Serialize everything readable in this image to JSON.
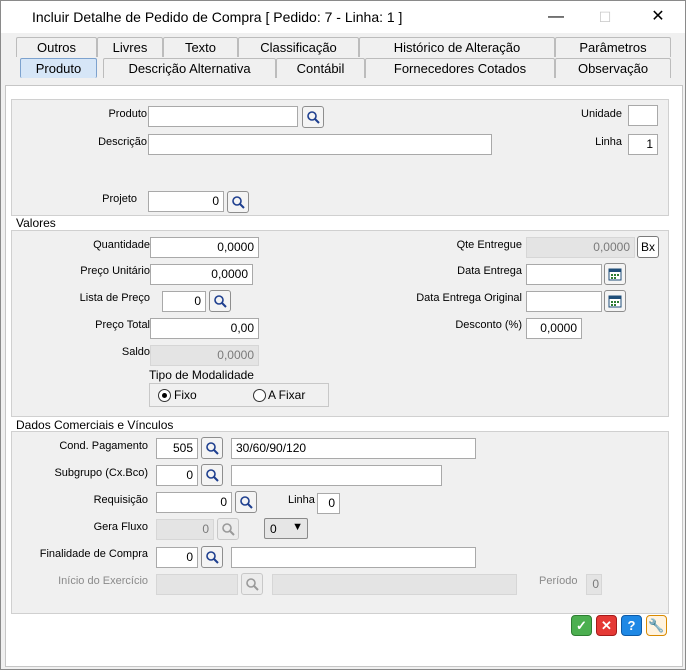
{
  "window": {
    "title": "Incluir Detalhe de Pedido de Compra [ Pedido: 7  -  Linha: 1 ]",
    "minimize_glyph": "—",
    "maximize_glyph": "☐",
    "close_glyph": "✕"
  },
  "tabs_row1": [
    "Outros",
    "Livres",
    "Texto",
    "Classificação",
    "Histórico de Alteração",
    "Parâmetros"
  ],
  "tabs_row2": [
    "Produto",
    "Descrição Alternativa",
    "Contábil",
    "Fornecedores Cotados",
    "Observação"
  ],
  "active_tab": "Produto",
  "produto": {
    "produto_label": "Produto",
    "produto_value": "",
    "unidade_label": "Unidade",
    "unidade_value": "",
    "descricao_label": "Descrição",
    "descricao_value": "",
    "linha_label": "Linha",
    "linha_value": "1",
    "projeto_label": "Projeto",
    "projeto_value": "0"
  },
  "valores": {
    "group_label": "Valores",
    "quantidade_label": "Quantidade",
    "quantidade_value": "0,0000",
    "preco_unitario_label": "Preço Unitário",
    "preco_unitario_value": "0,0000",
    "lista_preco_label": "Lista de Preço",
    "lista_preco_value": "0",
    "preco_total_label": "Preço Total",
    "preco_total_value": "0,00",
    "saldo_label": "Saldo",
    "saldo_value": "0,0000",
    "qte_entregue_label": "Qte Entregue",
    "qte_entregue_value": "0,0000",
    "bx_label": "Bx",
    "data_entrega_label": "Data Entrega",
    "data_entrega_value": "",
    "data_entrega_original_label": "Data Entrega Original",
    "data_entrega_original_value": "",
    "desconto_label": "Desconto (%)",
    "desconto_value": "0,0000",
    "modalidade_label": "Tipo de Modalidade",
    "modalidade_options": [
      "Fixo",
      "A Fixar"
    ],
    "modalidade_selected": "Fixo"
  },
  "comerciais": {
    "group_label": "Dados Comerciais e Vínculos",
    "cond_pagamento_label": "Cond. Pagamento",
    "cond_pagamento_code": "505",
    "cond_pagamento_desc": "30/60/90/120",
    "subgrupo_label": "Subgrupo (Cx.Bco)",
    "subgrupo_code": "0",
    "subgrupo_desc": "",
    "requisicao_label": "Requisição",
    "requisicao_value": "0",
    "req_linha_label": "Linha",
    "req_linha_value": "0",
    "gera_fluxo_label": "Gera Fluxo",
    "gera_fluxo_value": "0",
    "gera_fluxo_select": "0",
    "finalidade_label": "Finalidade de Compra",
    "finalidade_code": "0",
    "finalidade_desc": "",
    "inicio_exercicio_label": "Início do Exercício",
    "inicio_exercicio_value": "",
    "inicio_exercicio_desc": "",
    "periodo_label": "Período",
    "periodo_value": "0"
  },
  "actions": {
    "ok_icon": "check-icon",
    "cancel_icon": "x-icon",
    "help_icon": "question-icon",
    "tools_icon": "wrench-icon",
    "ok_color": "#4caf50",
    "cancel_color": "#e53935",
    "help_color": "#1e88e5",
    "tools_color": "#f39c12"
  }
}
